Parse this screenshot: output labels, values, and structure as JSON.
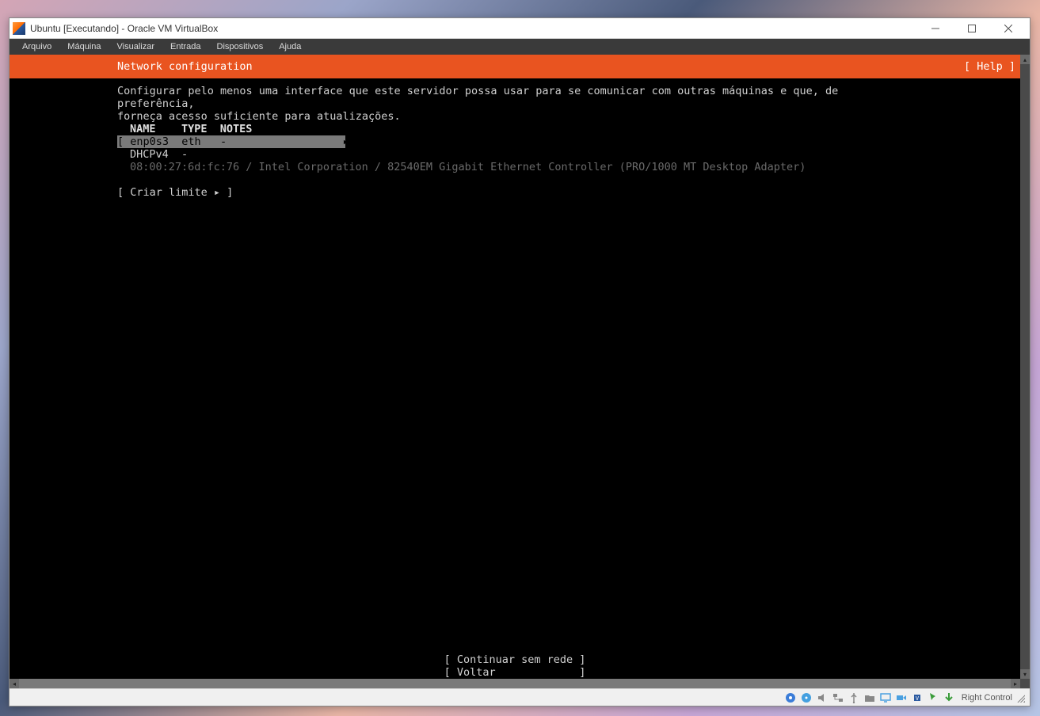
{
  "window": {
    "title": "Ubuntu [Executando] - Oracle VM VirtualBox"
  },
  "menubar": {
    "items": [
      "Arquivo",
      "Máquina",
      "Visualizar",
      "Entrada",
      "Dispositivos",
      "Ajuda"
    ]
  },
  "installer": {
    "header_title": "Network configuration",
    "help_label": "[ Help ]",
    "description": "Configurar pelo menos uma interface que este servidor possa usar para se comunicar com outras máquinas e que, de preferência,\nforneça acesso suficiente para atualizações.",
    "columns": "NAME    TYPE  NOTES",
    "interface_row": "[ enp0s3  eth   -                  ▸ ]",
    "dhcp_row": "DHCPv4  -",
    "mac_row": "08:00:27:6d:fc:76 / Intel Corporation / 82540EM Gigabit Ethernet Controller (PRO/1000 MT Desktop Adapter)",
    "create_limit": "[ Criar limite ▸ ]",
    "continue_btn": "[ Continuar sem rede ]",
    "back_btn": "[ Voltar             ]"
  },
  "statusbar": {
    "host_key": "Right Control"
  }
}
